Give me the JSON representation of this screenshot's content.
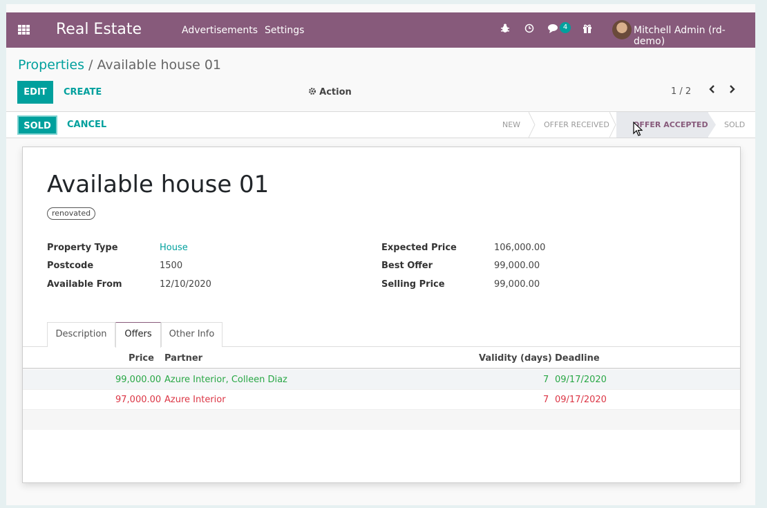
{
  "navbar": {
    "brand": "Real Estate",
    "menus": [
      "Advertisements",
      "Settings"
    ],
    "messages_badge": "4",
    "user": "Mitchell Admin (rd-demo)"
  },
  "breadcrumb": {
    "parent": "Properties",
    "separator": "/",
    "current": "Available house 01"
  },
  "controls": {
    "edit": "EDIT",
    "create": "CREATE",
    "action": "Action",
    "pager": "1 / 2"
  },
  "statusbar": {
    "sold_button": "SOLD",
    "cancel_button": "CANCEL",
    "stages": [
      "NEW",
      "OFFER RECEIVED",
      "OFFER ACCEPTED",
      "SOLD"
    ],
    "active_stage": "OFFER ACCEPTED"
  },
  "record": {
    "title": "Available house 01",
    "tag": "renovated",
    "fields_left": [
      {
        "label": "Property Type",
        "value": "House"
      },
      {
        "label": "Postcode",
        "value": "1500"
      },
      {
        "label": "Available From",
        "value": "12/10/2020"
      }
    ],
    "fields_right": [
      {
        "label": "Expected Price",
        "value": "106,000.00"
      },
      {
        "label": "Best Offer",
        "value": "99,000.00"
      },
      {
        "label": "Selling Price",
        "value": "99,000.00"
      }
    ]
  },
  "tabs": [
    "Description",
    "Offers",
    "Other Info"
  ],
  "active_tab": "Offers",
  "offers": {
    "columns": [
      "Price",
      "Partner",
      "Validity (days)",
      "Deadline"
    ],
    "rows": [
      {
        "price": "99,000.00",
        "partner": "Azure Interior, Colleen Diaz",
        "validity": "7",
        "deadline": "09/17/2020",
        "status": "accepted"
      },
      {
        "price": "97,000.00",
        "partner": "Azure Interior",
        "validity": "7",
        "deadline": "09/17/2020",
        "status": "refused"
      }
    ]
  },
  "colors": {
    "brand": "#875a7b",
    "accent": "#00a09d",
    "accepted": "#28a745",
    "refused": "#dc3545"
  }
}
